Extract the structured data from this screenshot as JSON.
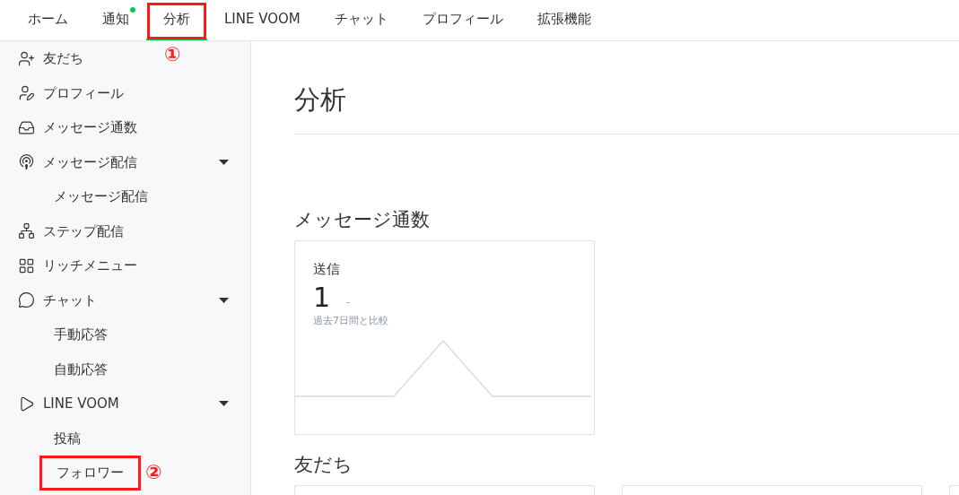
{
  "nav_tabs": [
    {
      "label": "ホーム",
      "selected": false,
      "badge": false
    },
    {
      "label": "通知",
      "selected": false,
      "badge": true
    },
    {
      "label": "分析",
      "selected": true,
      "badge": false,
      "annotation": "①"
    },
    {
      "label": "LINE VOOM",
      "selected": false,
      "badge": false
    },
    {
      "label": "チャット",
      "selected": false,
      "badge": false
    },
    {
      "label": "プロフィール",
      "selected": false,
      "badge": false
    },
    {
      "label": "拡張機能",
      "selected": false,
      "badge": false
    }
  ],
  "sidebar": {
    "items": [
      {
        "label": "友だち"
      },
      {
        "label": "プロフィール"
      },
      {
        "label": "メッセージ通数"
      },
      {
        "label": "メッセージ配信",
        "expanded": true,
        "children": [
          {
            "label": "メッセージ配信"
          }
        ]
      },
      {
        "label": "ステップ配信"
      },
      {
        "label": "リッチメニュー"
      },
      {
        "label": "チャット",
        "expanded": true,
        "children": [
          {
            "label": "手動応答"
          },
          {
            "label": "自動応答"
          }
        ]
      },
      {
        "label": "LINE VOOM",
        "expanded": true,
        "children": [
          {
            "label": "投稿"
          },
          {
            "label": "フォロワー",
            "annotation": "②"
          }
        ]
      }
    ]
  },
  "page_title": "分析",
  "sections": [
    {
      "title": "メッセージ通数",
      "cards": [
        {
          "kind": "stat",
          "label": "送信",
          "value": "1",
          "change": "-",
          "note": "過去7日間と比較"
        }
      ]
    },
    {
      "title": "友だち",
      "cards": [
        {
          "kind": "blank"
        },
        {
          "kind": "blank"
        },
        {
          "kind": "blank"
        }
      ]
    }
  ]
}
